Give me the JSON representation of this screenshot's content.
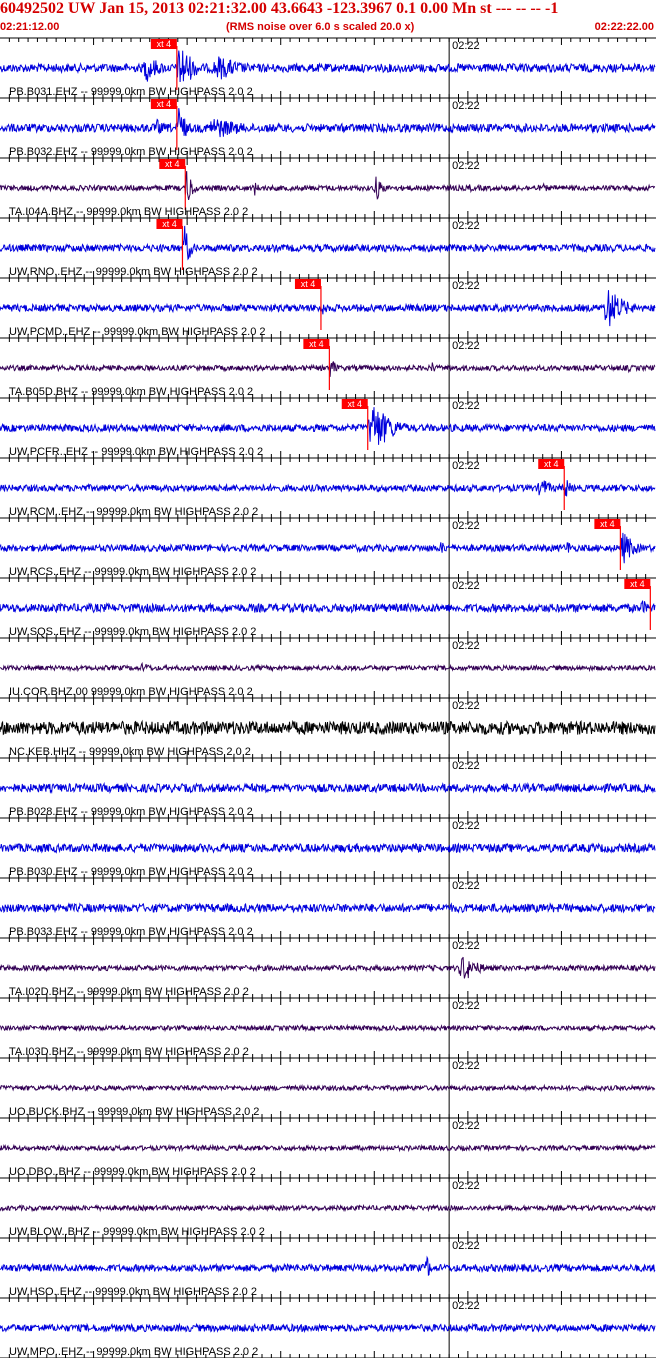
{
  "header": {
    "title": "60492502 UW Jan 15, 2013 02:21:32.00   43.6643 -123.3967  0.1 0.00 Mn st --- -- --  -1",
    "start_time": "02:21:12.00",
    "noise_note": "(RMS noise over 6.0 s scaled 20.0 x)",
    "end_time": "02:22:22.00"
  },
  "chart_data": {
    "type": "line",
    "title": "60492502 UW Jan 15, 2013 02:21:32.00   43.6643 -123.3967  0.1 0.00 Mn st --- -- --  -1",
    "x_range_seconds": [
      0,
      70
    ],
    "x_start_label": "02:21:12.00",
    "x_end_label": "02:22:22.00",
    "minute_tick_label": "02:22",
    "minute_tick_seconds": 48,
    "grid": true,
    "tick_interval_seconds": 1,
    "pick_label": "xt 4",
    "colors": {
      "header_text": "#d40000",
      "pick": "#ff0000",
      "pick_label": "#ffffff",
      "grid": "#000000"
    },
    "traces": [
      {
        "label": "PB.B031.EHZ -- 99999.0km BW  HIGHPASS  2.0  2",
        "color": "#0000dd",
        "noise": 0.35,
        "pick_s": 18.9,
        "events": [
          {
            "t": 15.2,
            "dur": 5,
            "amp": 1.6
          },
          {
            "t": 18.9,
            "dur": 4,
            "amp": 3.0
          },
          {
            "t": 22.5,
            "dur": 9,
            "amp": 1.4
          }
        ]
      },
      {
        "label": "PB.B032.EHZ -- 99999.0km BW  HIGHPASS  2.0  2",
        "color": "#0000dd",
        "noise": 0.35,
        "pick_s": 18.9,
        "events": [
          {
            "t": 16.5,
            "dur": 3,
            "amp": 1.0
          },
          {
            "t": 18.9,
            "dur": 2,
            "amp": 3.0
          },
          {
            "t": 22.0,
            "dur": 10,
            "amp": 1.3
          }
        ]
      },
      {
        "label": "TA.I04A.BHZ -- 99999.0km BW  HIGHPASS  2.0  2",
        "color": "#330055",
        "noise": 0.22,
        "pick_s": 19.8,
        "events": [
          {
            "t": 19.8,
            "dur": 1.8,
            "amp": 2.4
          },
          {
            "t": 27.0,
            "dur": 1.5,
            "amp": 1.0
          },
          {
            "t": 40.0,
            "dur": 2.0,
            "amp": 1.6
          },
          {
            "t": 50.0,
            "dur": 1.5,
            "amp": 0.6
          },
          {
            "t": 58.0,
            "dur": 1.5,
            "amp": 0.6
          }
        ]
      },
      {
        "label": "UW.RNO..EHZ -- 99999.0km BW  HIGHPASS  2.0  2",
        "color": "#0000dd",
        "noise": 0.3,
        "pick_s": 19.5,
        "events": [
          {
            "t": 19.5,
            "dur": 1.8,
            "amp": 3.0
          }
        ]
      },
      {
        "label": "UW.PCMD..EHZ -- 99999.0km BW  HIGHPASS  2.0  2",
        "color": "#0000dd",
        "noise": 0.3,
        "pick_s": 34.3,
        "events": [
          {
            "t": 34.3,
            "dur": 2,
            "amp": 0.8
          },
          {
            "t": 64.5,
            "dur": 5,
            "amp": 2.5
          }
        ]
      },
      {
        "label": "TA.B05D.BHZ -- 99999.0km BW  HIGHPASS  2.0  2",
        "color": "#330055",
        "noise": 0.22,
        "pick_s": 35.2,
        "events": [
          {
            "t": 35.2,
            "dur": 1.5,
            "amp": 1.5
          },
          {
            "t": 46.0,
            "dur": 1.5,
            "amp": 0.8
          },
          {
            "t": 67.0,
            "dur": 1.2,
            "amp": 0.6
          }
        ]
      },
      {
        "label": "UW.PCFR..EHZ -- 99999.0km BW  HIGHPASS  2.0  2",
        "color": "#0000dd",
        "noise": 0.3,
        "pick_s": 39.3,
        "events": [
          {
            "t": 39.3,
            "dur": 6,
            "amp": 3.0
          }
        ]
      },
      {
        "label": "UW.RCM..EHZ -- 99999.0km BW  HIGHPASS  2.0  2",
        "color": "#0000dd",
        "noise": 0.28,
        "pick_s": 60.3,
        "events": [
          {
            "t": 57.5,
            "dur": 3,
            "amp": 1.4
          },
          {
            "t": 60.3,
            "dur": 1.5,
            "amp": 1.4
          }
        ]
      },
      {
        "label": "UW.RCS..EHZ -- 99999.0km BW  HIGHPASS  2.0  2",
        "color": "#0000dd",
        "noise": 0.28,
        "pick_s": 66.3,
        "events": [
          {
            "t": 47.0,
            "dur": 2,
            "amp": 0.9
          },
          {
            "t": 60.5,
            "dur": 1.5,
            "amp": 1.0
          },
          {
            "t": 66.3,
            "dur": 3.5,
            "amp": 2.0
          }
        ]
      },
      {
        "label": "UW.SQS..EHZ -- 99999.0km BW  HIGHPASS  2.0  2",
        "color": "#0000dd",
        "noise": 0.35,
        "pick_s": 69.5,
        "events": [
          {
            "t": 27.0,
            "dur": 3,
            "amp": 0.6
          },
          {
            "t": 57.0,
            "dur": 6,
            "amp": 0.55
          },
          {
            "t": 68.5,
            "dur": 1.5,
            "amp": 1.2
          }
        ]
      },
      {
        "label": "IU.COR.BHZ.00 99999.0km BW  HIGHPASS  2.0  2",
        "color": "#330055",
        "noise": 0.2,
        "events": [
          {
            "t": 15.0,
            "dur": 3,
            "amp": 0.7
          }
        ]
      },
      {
        "label": "NC.KEB.HHZ -- 99999.0km BW  HIGHPASS  2.0  2",
        "color": "#000000",
        "noise": 0.55,
        "events": []
      },
      {
        "label": "PB.B028.EHZ -- 99999.0km BW  HIGHPASS  2.0  2",
        "color": "#0000dd",
        "noise": 0.35,
        "events": []
      },
      {
        "label": "PB.B030.EHZ -- 99999.0km BW  HIGHPASS  2.0  2",
        "color": "#0000dd",
        "noise": 0.35,
        "events": []
      },
      {
        "label": "PB.B033.EHZ -- 99999.0km BW  HIGHPASS  2.0  2",
        "color": "#0000dd",
        "noise": 0.35,
        "events": []
      },
      {
        "label": "TA.I02D.BHZ -- 99999.0km BW  HIGHPASS  2.0  2",
        "color": "#330055",
        "noise": 0.22,
        "events": [
          {
            "t": 49.0,
            "dur": 5,
            "amp": 1.6
          }
        ]
      },
      {
        "label": "TA.I03D.BHZ -- 99999.0km BW  HIGHPASS  2.0  2",
        "color": "#330055",
        "noise": 0.2,
        "events": []
      },
      {
        "label": "UO.BUCK.BHZ -- 99999.0km BW  HIGHPASS  2.0  2",
        "color": "#330055",
        "noise": 0.2,
        "events": []
      },
      {
        "label": "UO.DBO..BHZ -- 99999.0km BW  HIGHPASS  2.0  2",
        "color": "#330055",
        "noise": 0.2,
        "events": []
      },
      {
        "label": "UW.BLOW..BHZ -- 99999.0km BW  HIGHPASS  2.0  2",
        "color": "#330055",
        "noise": 0.2,
        "events": []
      },
      {
        "label": "UW.HSO..EHZ -- 99999.0km BW  HIGHPASS  2.0  2",
        "color": "#0000dd",
        "noise": 0.3,
        "events": [
          {
            "t": 45.5,
            "dur": 0.7,
            "amp": 3.0
          }
        ]
      },
      {
        "label": "UW.MPO..EHZ -- 99999.0km BW  HIGHPASS  2.0  2",
        "color": "#0000dd",
        "noise": 0.3,
        "events": []
      }
    ]
  }
}
